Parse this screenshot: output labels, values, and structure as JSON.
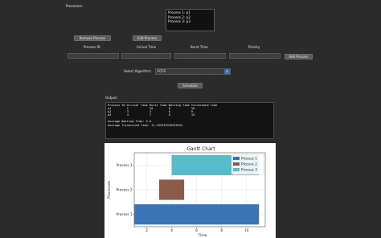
{
  "processes_label": "Processes:",
  "process_list": [
    "Process 1: p1",
    "Process 2: p2",
    "Process 3: p3"
  ],
  "buttons": {
    "remove": "Remove Process",
    "edit": "Edit Process",
    "add": "Add Process",
    "schedule": "Schedule"
  },
  "fields": {
    "process_id": "Process ID",
    "arrival_time": "Arrival Time",
    "burst_time": "Burst Time",
    "priority": "Priority"
  },
  "algorithm": {
    "label": "Select Algorithm:",
    "selected": "FCFS",
    "arrow": "⇕"
  },
  "output": {
    "label": "Output:",
    "text": "Process ID Arrival Time Burst Time Waiting Time Turnaround Time\np1         1            10         0            10\np2         3            3          6            9\np3         4            7          8            15\n\nAverage Waiting Time: 5.0\nAverage Turnaround Time: 11.333333333333334"
  },
  "chart_data": {
    "type": "bar",
    "orientation": "horizontal",
    "title": "Gantt Chart",
    "xlabel": "Time",
    "ylabel": "Processes",
    "categories": [
      "Process 1",
      "Process 2",
      "Process 3"
    ],
    "xlim": [
      1,
      11.5
    ],
    "xticks": [
      2,
      4,
      6,
      8,
      10
    ],
    "grid": true,
    "legend_position": "top-right",
    "series": [
      {
        "name": "Process 1",
        "start": 1,
        "end": 11,
        "color": "#3b74b4"
      },
      {
        "name": "Process 2",
        "start": 3,
        "end": 5,
        "color": "#8b5a48"
      },
      {
        "name": "Process 3",
        "start": 4,
        "end": 11,
        "color": "#56bccc"
      }
    ]
  }
}
